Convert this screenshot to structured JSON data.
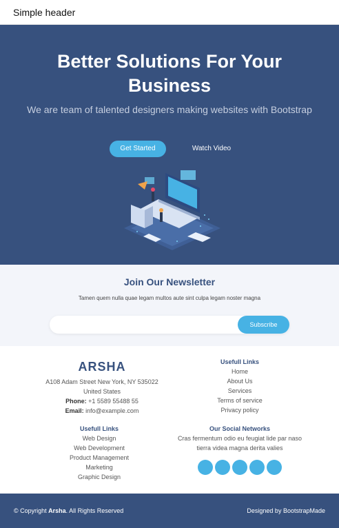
{
  "header": {
    "title": "Simple header"
  },
  "hero": {
    "title": "Better Solutions For Your Business",
    "subtitle": "We are team of talented designers making websites with Bootstrap",
    "primary_button": "Get Started",
    "secondary_button": "Watch Video"
  },
  "newsletter": {
    "title": "Join Our Newsletter",
    "text": "Tamen quem nulla quae legam multos aute sint culpa legam noster magna",
    "email_value": "",
    "button": "Subscribe"
  },
  "contact": {
    "brand": "ARSHA",
    "address1": "A108 Adam Street New York, NY 535022",
    "address2": "United States",
    "phone_label": "Phone:",
    "phone": "+1 5589 55488 55",
    "email_label": "Email:",
    "email": "info@example.com"
  },
  "links_a": {
    "title": "Usefull Links",
    "items": [
      "Home",
      "About Us",
      "Services",
      "Terms of service",
      "Privacy policy"
    ]
  },
  "links_b": {
    "title": "Usefull Links",
    "items": [
      "Web Design",
      "Web Development",
      "Product Management",
      "Marketing",
      "Graphic Design"
    ]
  },
  "social": {
    "title": "Our Social Networks",
    "text": "Cras fermentum odio eu feugiat lide par naso tierra videa magna derita valies",
    "icons": [
      "twitter-icon",
      "facebook-icon",
      "instagram-icon",
      "skype-icon",
      "linkedin-icon"
    ]
  },
  "footer": {
    "copyright_prefix": "© Copyright ",
    "brand": "Arsha",
    "copyright_suffix": ". All Rights Reserved",
    "credit_prefix": "Designed by ",
    "credit_brand": "BootstrapMade"
  },
  "colors": {
    "primary": "#37517e",
    "accent": "#47b2e4",
    "light_bg": "#f3f5fa"
  }
}
